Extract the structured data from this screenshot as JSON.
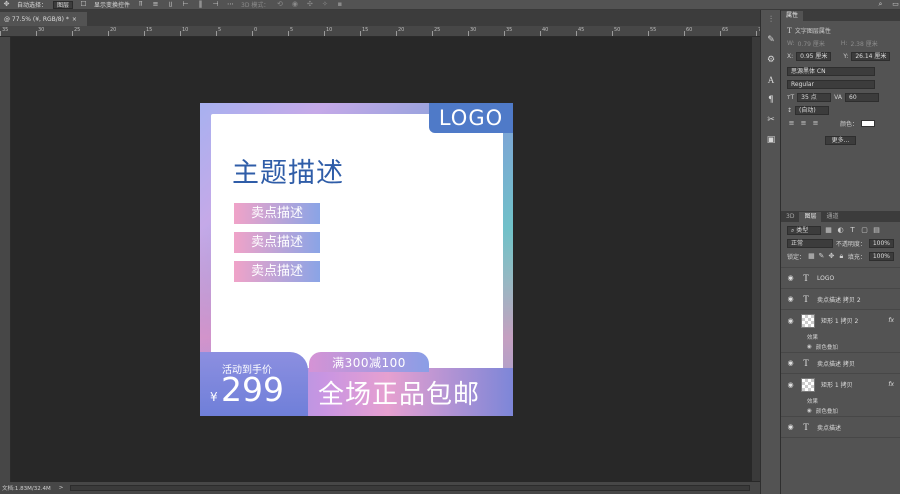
{
  "optbar": {
    "auto_select": "自动选择：",
    "auto_select_value": "图层",
    "show_transform": "显示变换控件",
    "mode_3d": "3D 模式："
  },
  "doc_tab": {
    "title": "@ 77.5% (¥, RGB/8) *",
    "close": "×"
  },
  "ruler_h_ticks": [
    "35",
    "30",
    "25",
    "20",
    "15",
    "10",
    "5",
    "0",
    "5",
    "10",
    "15",
    "20",
    "25",
    "30",
    "35",
    "40",
    "45",
    "50",
    "55",
    "60",
    "65",
    "70"
  ],
  "status": {
    "zoom": "77.5%",
    "doc": "文档:1.83M/32.4M",
    "arrow": ">"
  },
  "properties": {
    "tab": "属性",
    "kind": "文字图层属性",
    "w_label": "W:",
    "w_value": "0.79 厘米",
    "h_label": "H:",
    "h_value": "2.38 厘米",
    "x_label": "X:",
    "x_value": "0.95 厘米",
    "y_label": "Y:",
    "y_value": "26.14 厘米",
    "font_family": "思源黑体 CN",
    "font_style": "Regular",
    "font_size": "35 点",
    "tracking": "60",
    "leading": "(自动)",
    "color_label": "颜色：",
    "more_button": "更多..."
  },
  "layers_panel": {
    "tabs": [
      "3D",
      "图层",
      "通道"
    ],
    "filter": "类型",
    "blend_mode": "正常",
    "opacity_label": "不透明度：",
    "opacity": "100%",
    "lock_label": "锁定：",
    "fill_label": "填充：",
    "fill": "100%",
    "layers": [
      {
        "type": "text",
        "name": "LOGO"
      },
      {
        "type": "text",
        "name": "卖点描述 拷贝 2"
      },
      {
        "type": "shape",
        "name": "矩形 1 拷贝 2",
        "fx": "fx",
        "effects": [
          "效果",
          "颜色叠加"
        ]
      },
      {
        "type": "text",
        "name": "卖点描述 拷贝"
      },
      {
        "type": "shape",
        "name": "矩形 1 拷贝",
        "fx": "fx",
        "effects": [
          "效果",
          "颜色叠加"
        ]
      },
      {
        "type": "text",
        "name": "卖点描述"
      }
    ]
  },
  "artwork": {
    "logo": "LOGO",
    "title": "主题描述",
    "selling_points": [
      "卖点描述",
      "卖点描述",
      "卖点描述"
    ],
    "activity_label": "活动到手价",
    "currency": "¥",
    "price": "299",
    "promo": "满300减100",
    "slogan": "全场正品包邮"
  },
  "colors": {
    "ui_bg": "#282828",
    "panel_bg": "#535353",
    "logo_badge": "#4f7ac8",
    "title_blue": "#2f5da8"
  }
}
